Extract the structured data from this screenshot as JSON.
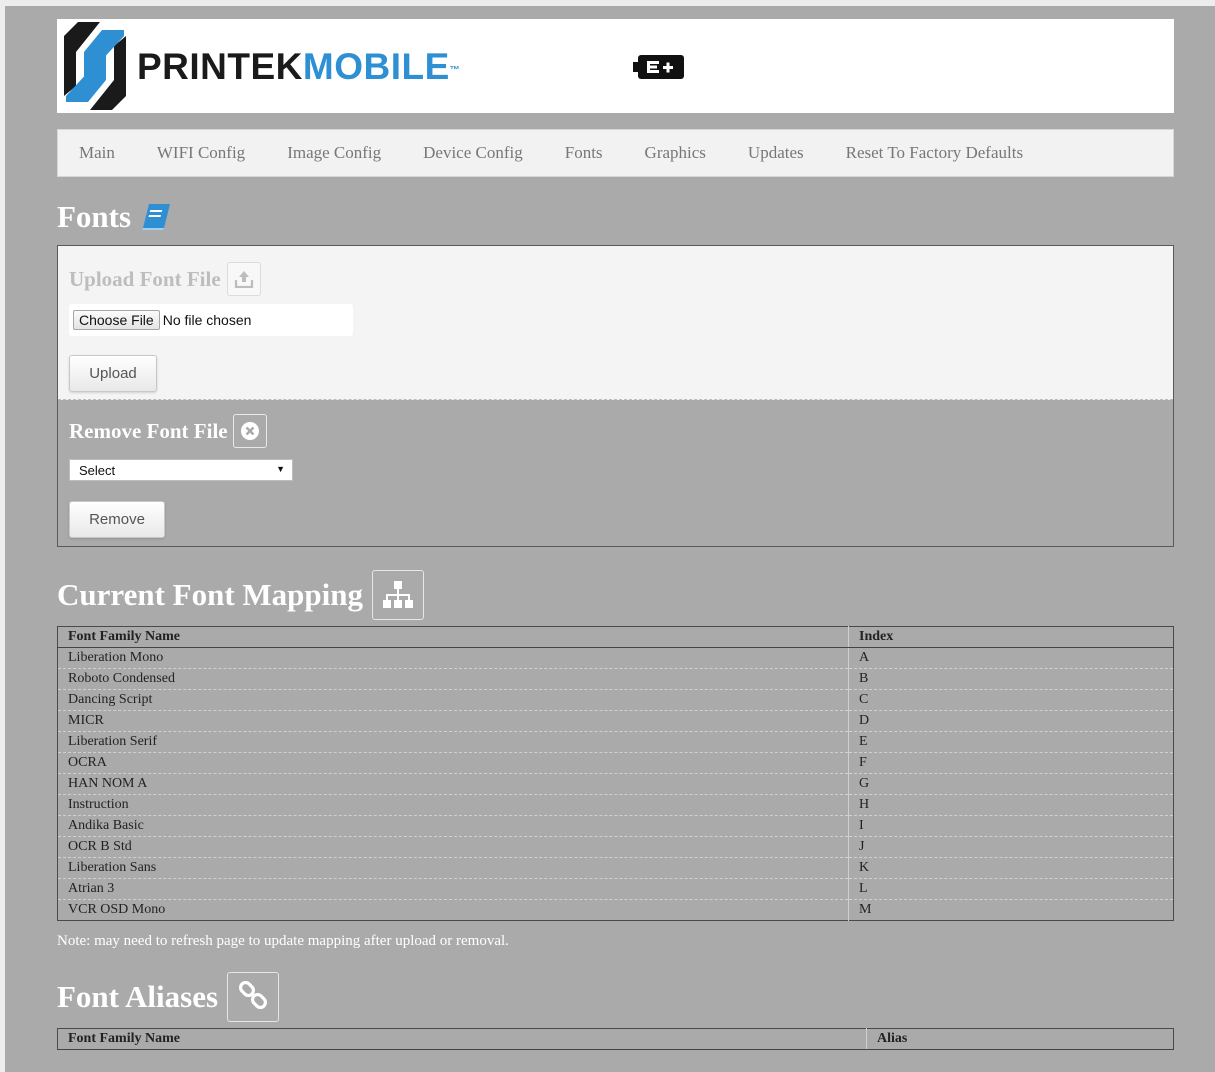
{
  "header": {
    "brand_part1": "PRINTEK",
    "brand_part2": "MOBILE",
    "trademark": "™",
    "colors": {
      "brand_blue": "#2e90d3",
      "brand_dark": "#1a1a1a"
    },
    "status_icon": "battery-icon"
  },
  "nav": {
    "items": [
      {
        "label": "Main"
      },
      {
        "label": "WIFI Config"
      },
      {
        "label": "Image Config"
      },
      {
        "label": "Device Config"
      },
      {
        "label": "Fonts"
      },
      {
        "label": "Graphics"
      },
      {
        "label": "Updates"
      },
      {
        "label": "Reset To Factory Defaults"
      }
    ]
  },
  "page": {
    "title": "Fonts",
    "title_icon": "book-icon"
  },
  "upload": {
    "title": "Upload Font File",
    "icon": "upload-icon",
    "choose_label": "Choose File",
    "no_file_label": "No file chosen",
    "button_label": "Upload"
  },
  "remove": {
    "title": "Remove Font File",
    "icon": "remove-circle-icon",
    "select_value": "Select",
    "button_label": "Remove"
  },
  "mapping": {
    "title": "Current Font Mapping",
    "icon": "sitemap-icon",
    "headers": {
      "name": "Font Family Name",
      "index": "Index"
    },
    "rows": [
      {
        "name": "Liberation Mono",
        "index": "A"
      },
      {
        "name": "Roboto Condensed",
        "index": "B"
      },
      {
        "name": "Dancing Script",
        "index": "C"
      },
      {
        "name": "MICR",
        "index": "D"
      },
      {
        "name": "Liberation Serif",
        "index": "E"
      },
      {
        "name": "OCRA",
        "index": "F"
      },
      {
        "name": "HAN NOM A",
        "index": "G"
      },
      {
        "name": "Instruction",
        "index": "H"
      },
      {
        "name": "Andika Basic",
        "index": "I"
      },
      {
        "name": "OCR B Std",
        "index": "J"
      },
      {
        "name": "Liberation Sans",
        "index": "K"
      },
      {
        "name": "Atrian 3",
        "index": "L"
      },
      {
        "name": "VCR OSD Mono",
        "index": "M"
      }
    ],
    "note": "Note: may need to refresh page to update mapping after upload or removal."
  },
  "aliases": {
    "title": "Font Aliases",
    "icon": "link-icon",
    "headers": {
      "name": "Font Family Name",
      "alias": "Alias"
    }
  }
}
